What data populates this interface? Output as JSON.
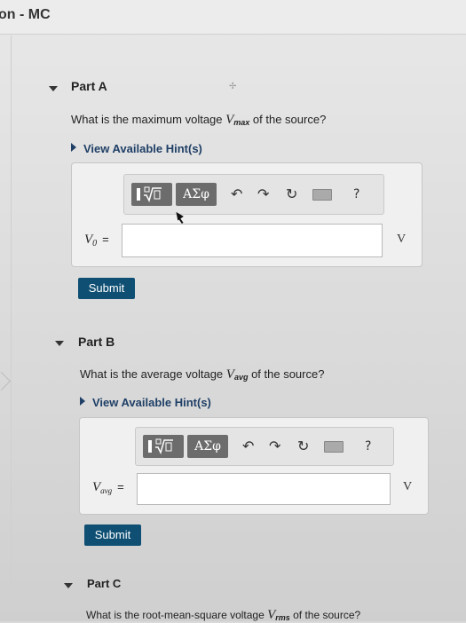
{
  "header": {
    "title": "on - MC"
  },
  "parts": [
    {
      "label": "Part A",
      "question_pre": "What is the maximum voltage ",
      "var_main": "V",
      "var_sub": "max",
      "question_post": " of the source?",
      "hint": "View Available Hint(s)",
      "answer_var": "V",
      "answer_sub": "0",
      "equals": "=",
      "unit": "V",
      "submit": "Submit"
    },
    {
      "label": "Part B",
      "question_pre": "What is the average voltage ",
      "var_main": "V",
      "var_sub": "avg",
      "question_post": " of the source?",
      "hint": "View Available Hint(s)",
      "answer_var": "V",
      "answer_sub": "avg",
      "equals": "=",
      "unit": "V",
      "submit": "Submit"
    },
    {
      "label": "Part C",
      "question_pre": "What is the root-mean-square voltage ",
      "var_main": "V",
      "var_sub": "rms",
      "question_post": " of the source?"
    }
  ],
  "toolbar": {
    "templates_icon": "fraction-sqrt-template-icon",
    "symbols_label": "ΑΣφ",
    "undo_icon": "undo-icon",
    "redo_icon": "redo-icon",
    "reset_icon": "reset-icon",
    "keyboard_icon": "keyboard-icon",
    "help_label": "?"
  },
  "colors": {
    "submit_bg": "#0e4f73",
    "hint_text": "#1f3f66",
    "toolbar_button": "#6c6c6c"
  }
}
